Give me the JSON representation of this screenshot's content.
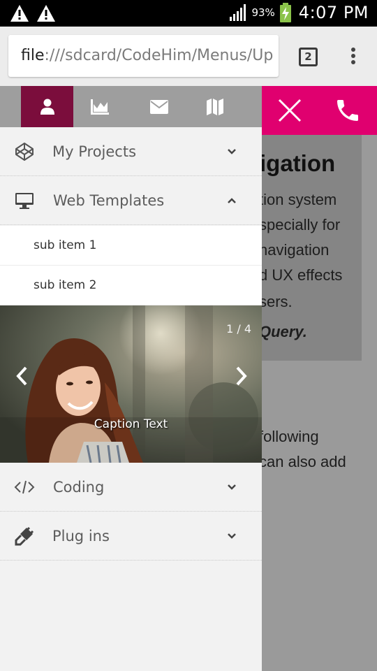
{
  "status_bar": {
    "battery_percent": "93%",
    "time": "4:07 PM",
    "icons": [
      "warning-icon",
      "warning-icon",
      "signal-icon",
      "battery-charging-icon"
    ]
  },
  "browser": {
    "url_scheme": "file",
    "url_rest": ":///sdcard/CodeHim/Menus/Up",
    "tab_count": "2",
    "menu_icon": "overflow-menu-icon"
  },
  "background_page": {
    "heading_fragment": "igation",
    "lines": [
      "tion system",
      "specially for",
      "navigation",
      "d UX effects",
      "sers."
    ],
    "italic_line": "Query.",
    "lower_lines": [
      "following",
      "can also add"
    ]
  },
  "header_actions": {
    "close_icon": "close-icon",
    "phone_icon": "phone-icon",
    "accent_color": "#e0006f"
  },
  "drawer": {
    "tabs": [
      {
        "icon": "user-icon",
        "active": true
      },
      {
        "icon": "chart-icon",
        "active": false
      },
      {
        "icon": "mail-icon",
        "active": false
      },
      {
        "icon": "map-icon",
        "active": false
      }
    ],
    "active_tab_color": "#7b0d3c",
    "items": [
      {
        "label": "My Projects",
        "icon": "codepen-icon",
        "expanded": false
      },
      {
        "label": "Web Templates",
        "icon": "desktop-icon",
        "expanded": true
      },
      {
        "label": "Coding",
        "icon": "code-icon",
        "expanded": false
      },
      {
        "label": "Plug ins",
        "icon": "plug-icon",
        "expanded": false
      }
    ],
    "sub_items": [
      "sub item 1",
      "sub item 2"
    ],
    "carousel": {
      "counter": "1 / 4",
      "caption": "Caption Text"
    }
  }
}
